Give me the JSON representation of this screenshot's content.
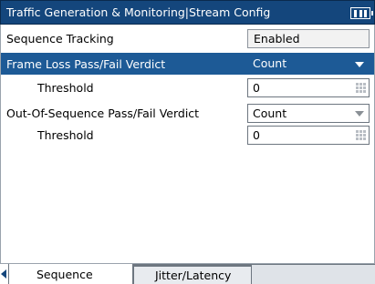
{
  "header": {
    "title": "Traffic Generation  & Monitoring|Stream Config"
  },
  "rows": [
    {
      "label": "Sequence Tracking",
      "value": "Enabled"
    },
    {
      "label": "Frame Loss Pass/Fail Verdict",
      "value": "Count"
    },
    {
      "label": "Threshold",
      "value": "0"
    },
    {
      "label": "Out-Of-Sequence Pass/Fail Verdict",
      "value": "Count"
    },
    {
      "label": "Threshold",
      "value": "0"
    }
  ],
  "tabs": [
    {
      "label": "Sequence"
    },
    {
      "label": "Jitter/Latency"
    }
  ],
  "colors": {
    "title_bar": "#14467c",
    "selected_row": "#1d5a96"
  }
}
